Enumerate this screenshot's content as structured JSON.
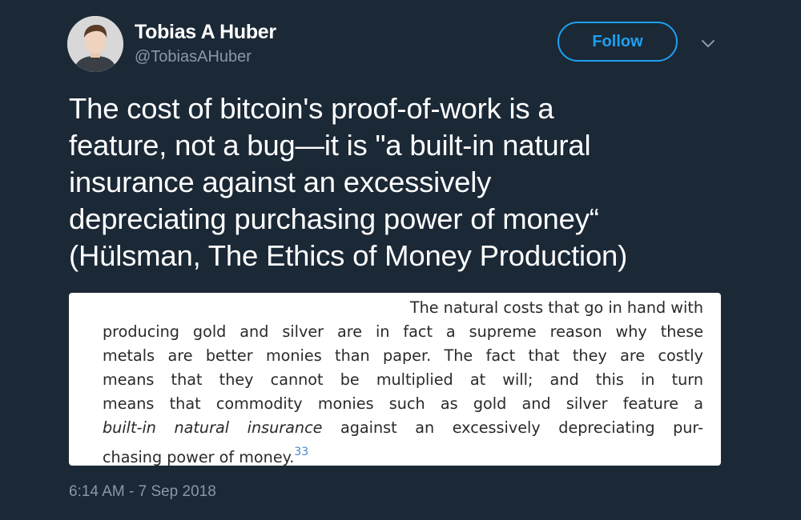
{
  "author": {
    "name": "Tobias A Huber",
    "handle": "@TobiasAHuber"
  },
  "follow_label": "Follow",
  "tweet": {
    "lines": [
      "The cost of bitcoin's proof-of-work is a",
      "feature, not a bug—it is \"a built-in natural",
      "insurance against an excessively",
      "depreciating purchasing power of money“",
      "(Hülsman, The Ethics of Money Production)"
    ]
  },
  "media": {
    "quote_lines": [
      "The natural costs that go in hand with",
      "producing gold and silver are in fact a supreme reason why these",
      "metals are better monies than paper. The fact that they are costly",
      "means that they cannot be multiplied at will; and this in turn",
      "means that commodity monies such as gold and silver feature a"
    ],
    "italic_phrase": "built-in natural insurance",
    "line6_rest": " against an excessively depreciating pur-",
    "last_line": "chasing power of money.",
    "footnote": "33"
  },
  "timestamp": "6:14 AM - 7 Sep 2018",
  "colors": {
    "background": "#1b2836",
    "accent": "#1da1f2",
    "muted": "#8899a6"
  },
  "icons": {
    "caret": "chevron-down-icon"
  }
}
